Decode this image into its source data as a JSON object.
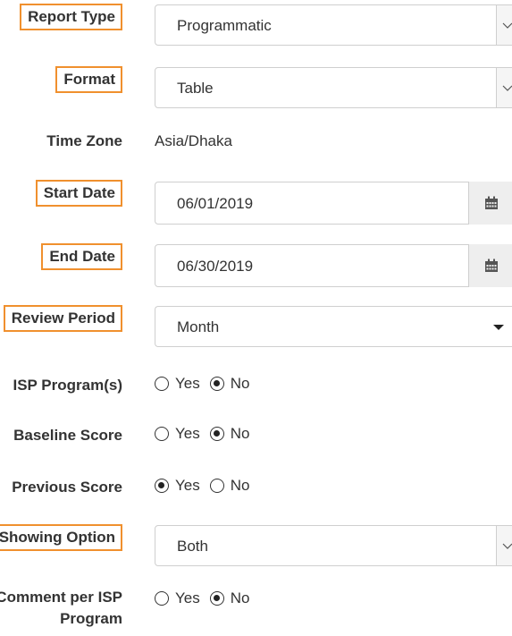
{
  "form": {
    "report_type": {
      "label": "Report Type",
      "value": "Programmatic"
    },
    "format": {
      "label": "Format",
      "value": "Table"
    },
    "time_zone": {
      "label": "Time Zone",
      "value": "Asia/Dhaka"
    },
    "start_date": {
      "label": "Start Date",
      "value": "06/01/2019"
    },
    "end_date": {
      "label": "End Date",
      "value": "06/30/2019"
    },
    "review_period": {
      "label": "Review Period",
      "value": "Month"
    },
    "isp_programs": {
      "label": "ISP Program(s)",
      "yes": "Yes",
      "no": "No",
      "selected": "No"
    },
    "baseline_score": {
      "label": "Baseline Score",
      "yes": "Yes",
      "no": "No",
      "selected": "No"
    },
    "previous_score": {
      "label": "Previous Score",
      "yes": "Yes",
      "no": "No",
      "selected": "Yes"
    },
    "showing_option": {
      "label": "Showing Option",
      "value": "Both"
    },
    "comment_per_isp": {
      "label_line1": "Comment per ISP",
      "label_line2": "Program",
      "yes": "Yes",
      "no": "No",
      "selected": "No"
    }
  },
  "icons": {
    "calendar": "calendar-icon",
    "select_arrow": "chevron-down-icon",
    "caret": "caret-down-icon"
  },
  "colors": {
    "highlight_border": "#f0902e",
    "text": "#333333",
    "input_border": "#cfcfcf",
    "addon_bg": "#eeeeee"
  }
}
